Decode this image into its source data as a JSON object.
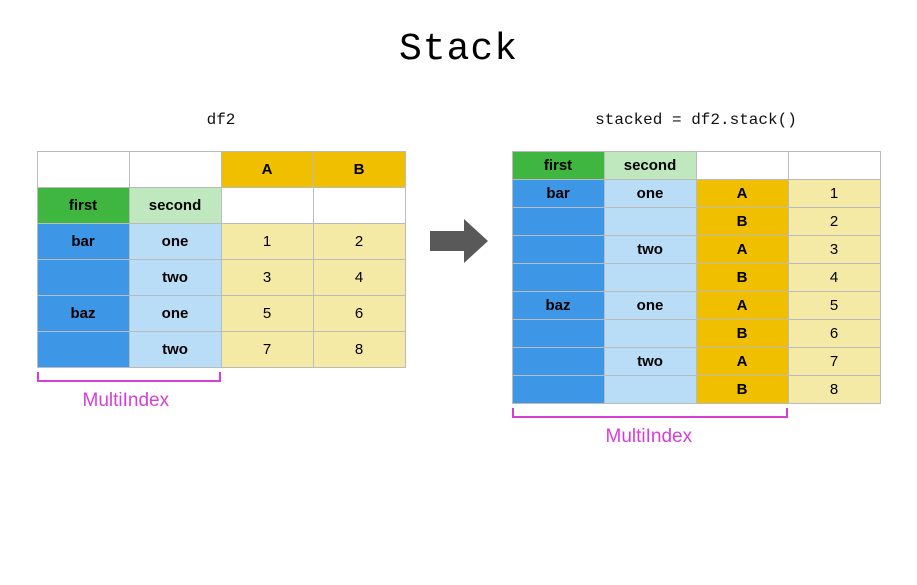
{
  "title": "Stack",
  "left": {
    "caption": "df2",
    "idx_names": [
      "first",
      "second"
    ],
    "col_names": [
      "A",
      "B"
    ],
    "rows": [
      {
        "first": "bar",
        "second": "one",
        "vals": [
          1,
          2
        ]
      },
      {
        "first": "",
        "second": "two",
        "vals": [
          3,
          4
        ]
      },
      {
        "first": "baz",
        "second": "one",
        "vals": [
          5,
          6
        ]
      },
      {
        "first": "",
        "second": "two",
        "vals": [
          7,
          8
        ]
      }
    ],
    "bracket_label": "MultiIndex"
  },
  "right": {
    "caption": "stacked = df2.stack()",
    "idx_names": [
      "first",
      "second"
    ],
    "rows": [
      {
        "first": "bar",
        "second": "one",
        "col": "A",
        "val": 1
      },
      {
        "first": "",
        "second": "",
        "col": "B",
        "val": 2
      },
      {
        "first": "",
        "second": "two",
        "col": "A",
        "val": 3
      },
      {
        "first": "",
        "second": "",
        "col": "B",
        "val": 4
      },
      {
        "first": "baz",
        "second": "one",
        "col": "A",
        "val": 5
      },
      {
        "first": "",
        "second": "",
        "col": "B",
        "val": 6
      },
      {
        "first": "",
        "second": "two",
        "col": "A",
        "val": 7
      },
      {
        "first": "",
        "second": "",
        "col": "B",
        "val": 8
      }
    ],
    "bracket_label": "MultiIndex"
  },
  "colors": {
    "green_d": "#3fb63f",
    "green_l": "#bfe8bf",
    "blue_d": "#3d97e6",
    "blue_l": "#b9dcf7",
    "gold_d": "#f0c000",
    "gold_l": "#f5e9a6",
    "arrow": "#595959",
    "magenta": "#d63fd6"
  }
}
